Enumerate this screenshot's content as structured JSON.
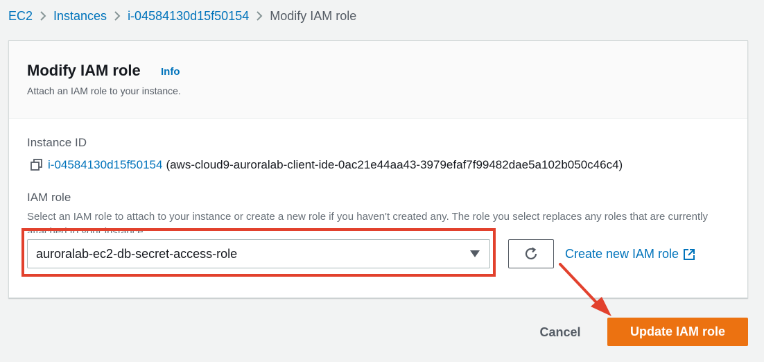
{
  "breadcrumb": {
    "items": [
      "EC2",
      "Instances",
      "i-04584130d15f50154"
    ],
    "current": "Modify IAM role"
  },
  "header": {
    "title": "Modify IAM role",
    "info": "Info",
    "description": "Attach an IAM role to your instance."
  },
  "instance": {
    "label": "Instance ID",
    "id": "i-04584130d15f50154",
    "name": "(aws-cloud9-auroralab-client-ide-0ac21e44aa43-3979efaf7f99482dae5a102b050c46c4)"
  },
  "iam_role": {
    "label": "IAM role",
    "description": "Select an IAM role to attach to your instance or create a new role if you haven't created any. The role you select replaces any roles that are currently attached to your instance.",
    "selected": "auroralab-ec2-db-secret-access-role",
    "create_link": "Create new IAM role"
  },
  "footer": {
    "cancel": "Cancel",
    "submit": "Update IAM role"
  },
  "colors": {
    "link": "#0073bb",
    "primary": "#ec7211",
    "annotation": "#e2412d"
  },
  "icons": [
    "chevron-right-icon",
    "copy-icon",
    "caret-down-icon",
    "refresh-icon",
    "external-link-icon"
  ]
}
